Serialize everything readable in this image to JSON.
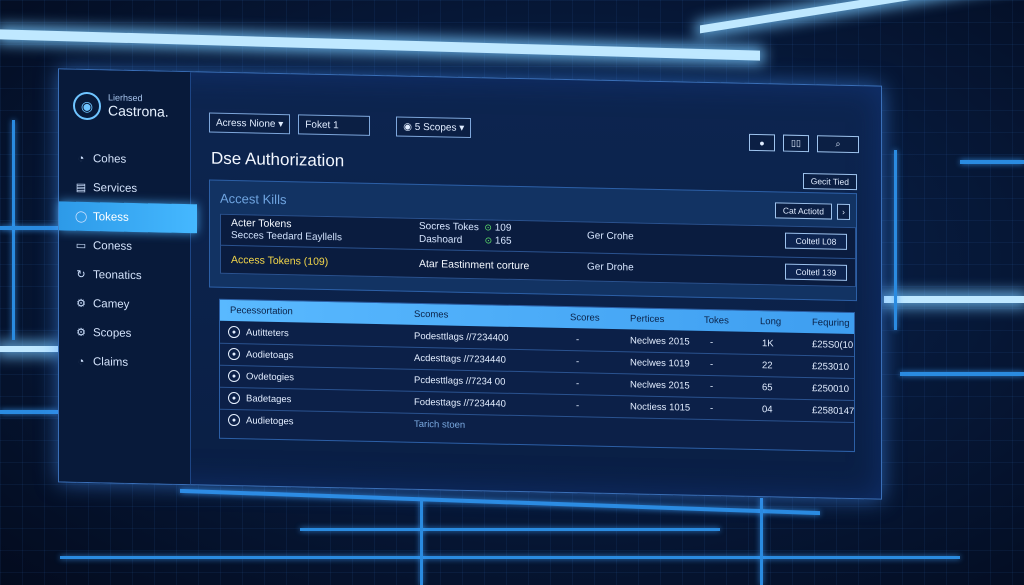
{
  "sidebar": {
    "brand_sub": "Lierhsed",
    "brand_name": "Castrona.",
    "items": [
      {
        "label": "Cohes",
        "icon": "clock-icon"
      },
      {
        "label": "Services",
        "icon": "building-icon"
      },
      {
        "label": "Tokess",
        "icon": "circle-icon",
        "active": true
      },
      {
        "label": "Coness",
        "icon": "card-icon"
      },
      {
        "label": "Teonatics",
        "icon": "refresh-icon"
      },
      {
        "label": "Camey",
        "icon": "gear-icon"
      },
      {
        "label": "Scopes",
        "icon": "gear-icon"
      },
      {
        "label": "Claims",
        "icon": "clock-icon"
      }
    ]
  },
  "toolbar": {
    "access_select": "Acress Nione",
    "token_input": "Foket 1",
    "scopes_select": "5 Scopes",
    "right_btn_1": "",
    "right_btn_2": "",
    "right_btn_3": ""
  },
  "page": {
    "title": "Dse Authorization",
    "top_right_button": "Gecit Tied"
  },
  "panel": {
    "title": "Accest Kills",
    "action_button": "Cat Actiotd",
    "rows": [
      {
        "name": "Acter Tokens",
        "sub": "Secces Teedard Eayllells",
        "mid_1": "Socres Tokes",
        "mid_1_val": "109",
        "mid_2": "Dashoard",
        "mid_2_val": "165",
        "status": "Ger Crohe",
        "button": "Coltetl L08"
      },
      {
        "name": "Access Tokens (109)",
        "mid": "Atar Eastinment corture",
        "status": "Ger Drohe",
        "button": "Coltetl 139"
      }
    ]
  },
  "table": {
    "headers": [
      "Pecessortation",
      "Scomes",
      "Scores",
      "Pertices",
      "Tokes",
      "Long",
      "Fequring"
    ],
    "rows": [
      {
        "name": "Autitteters",
        "scope": "Podesttlags //7234400",
        "score": "-",
        "period": "Neclwes 2015",
        "tokes": "-",
        "long": "1K",
        "freq": "£25S0(10"
      },
      {
        "name": "Aodietoags",
        "scope": "Acdesttags //7234440",
        "score": "-",
        "period": "Neclwes 1019",
        "tokes": "-",
        "long": "22",
        "freq": "£253010"
      },
      {
        "name": "Ovdetogies",
        "scope": "Pcdesttlags //7234 00",
        "score": "-",
        "period": "Neclwes 2015",
        "tokes": "-",
        "long": "65",
        "freq": "£250010"
      },
      {
        "name": "Badetages",
        "scope": "Fodesttags //7234440",
        "score": "-",
        "period": "Noctiess 1015",
        "tokes": "-",
        "long": "04",
        "freq": "£2580147"
      },
      {
        "name": "Audietoges",
        "scope": "Tarich stoen",
        "score": "",
        "period": "",
        "tokes": "",
        "long": "",
        "freq": ""
      }
    ]
  }
}
